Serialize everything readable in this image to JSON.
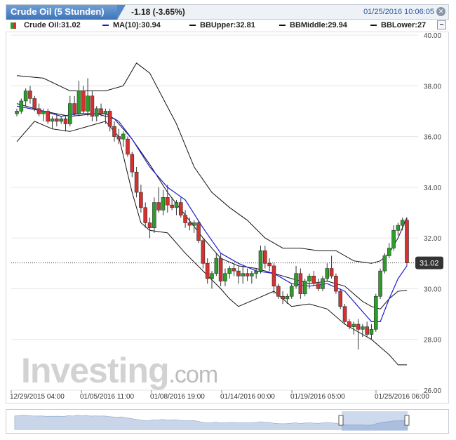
{
  "header": {
    "title": "Crude Oil (5 Stunden)",
    "change": "-1.18 (-3.65%)",
    "datetime": "01/25/2016 10:06:05"
  },
  "legend": {
    "price": "Crude Oil:31.02",
    "ma": "MA(10):30.94",
    "bb_upper": "BBUpper:32.81",
    "bb_middle": "BBMiddle:29.94",
    "bb_lower": "BBLower:27"
  },
  "colors": {
    "up": "#2a9d2a",
    "down": "#d63030",
    "ma": "#1a1ad6",
    "bands": "#111111",
    "grid": "#e3e6ea",
    "navigator": "#6f93c8"
  },
  "watermark": "Investing.com",
  "last_price_label": "31.02",
  "chart_data": {
    "type": "candlestick",
    "ylim": [
      26,
      40
    ],
    "yticks": [
      "40.00",
      "38.00",
      "36.00",
      "34.00",
      "32.00",
      "30.00",
      "28.00",
      "26.00"
    ],
    "xticks": [
      "12/29/2015 04:00",
      "01/05/2016 11:00",
      "01/08/2016 19:00",
      "01/14/2016 00:00",
      "01/19/2016 05:00",
      "01/25/2016 06:00"
    ],
    "last_price": 31.02,
    "candles": [
      [
        36.9,
        37.1,
        36.8,
        37.0
      ],
      [
        37.0,
        37.5,
        36.9,
        37.4
      ],
      [
        37.4,
        37.9,
        37.2,
        37.8
      ],
      [
        37.8,
        38.0,
        37.3,
        37.5
      ],
      [
        37.5,
        37.6,
        37.0,
        37.1
      ],
      [
        37.1,
        37.3,
        36.8,
        36.9
      ],
      [
        36.9,
        37.1,
        36.6,
        37.0
      ],
      [
        37.0,
        37.1,
        36.5,
        36.6
      ],
      [
        36.6,
        36.8,
        36.3,
        36.7
      ],
      [
        36.7,
        36.9,
        36.4,
        36.6
      ],
      [
        36.6,
        36.8,
        36.5,
        36.7
      ],
      [
        36.7,
        36.8,
        36.2,
        36.5
      ],
      [
        36.5,
        37.6,
        36.4,
        37.3
      ],
      [
        37.3,
        37.6,
        36.8,
        36.9
      ],
      [
        36.9,
        38.2,
        36.8,
        37.8
      ],
      [
        37.8,
        38.0,
        36.9,
        37.0
      ],
      [
        37.0,
        38.3,
        36.8,
        37.6
      ],
      [
        37.6,
        37.8,
        36.6,
        36.8
      ],
      [
        36.8,
        37.2,
        36.6,
        37.1
      ],
      [
        37.1,
        37.3,
        36.8,
        36.9
      ],
      [
        36.9,
        37.1,
        36.5,
        37.0
      ],
      [
        37.0,
        37.1,
        36.2,
        36.4
      ],
      [
        36.4,
        36.6,
        35.8,
        36.0
      ],
      [
        36.0,
        36.3,
        35.7,
        35.9
      ],
      [
        35.9,
        36.2,
        35.6,
        36.1
      ],
      [
        35.9,
        36.0,
        35.2,
        35.3
      ],
      [
        35.3,
        35.4,
        34.4,
        34.6
      ],
      [
        34.6,
        34.8,
        33.6,
        33.8
      ],
      [
        33.8,
        34.1,
        33.0,
        33.2
      ],
      [
        33.2,
        33.4,
        32.4,
        32.6
      ],
      [
        32.6,
        32.8,
        32.0,
        32.4
      ],
      [
        32.4,
        33.6,
        32.2,
        33.4
      ],
      [
        33.4,
        34.0,
        33.0,
        33.1
      ],
      [
        33.1,
        33.9,
        32.9,
        33.6
      ],
      [
        33.6,
        34.1,
        33.0,
        33.3
      ],
      [
        33.3,
        33.6,
        33.1,
        33.2
      ],
      [
        33.2,
        33.5,
        32.9,
        33.4
      ],
      [
        33.4,
        33.6,
        32.8,
        32.9
      ],
      [
        32.9,
        33.1,
        32.4,
        32.6
      ],
      [
        32.6,
        32.8,
        32.3,
        32.5
      ],
      [
        32.5,
        32.7,
        32.2,
        32.6
      ],
      [
        32.6,
        32.7,
        31.8,
        31.9
      ],
      [
        31.9,
        32.0,
        30.8,
        31.0
      ],
      [
        31.0,
        31.2,
        30.2,
        30.4
      ],
      [
        30.4,
        30.7,
        30.0,
        30.6
      ],
      [
        30.6,
        31.4,
        30.5,
        31.2
      ],
      [
        31.2,
        31.4,
        30.1,
        30.3
      ],
      [
        30.3,
        30.8,
        30.1,
        30.6
      ],
      [
        30.6,
        30.9,
        30.4,
        30.8
      ],
      [
        30.8,
        31.0,
        30.5,
        30.7
      ],
      [
        30.7,
        30.9,
        30.2,
        30.5
      ],
      [
        30.5,
        30.9,
        30.2,
        30.6
      ],
      [
        30.6,
        30.8,
        30.3,
        30.5
      ],
      [
        30.5,
        30.7,
        30.2,
        30.6
      ],
      [
        30.6,
        30.8,
        30.4,
        30.7
      ],
      [
        30.7,
        31.7,
        30.6,
        31.5
      ],
      [
        31.5,
        31.7,
        30.8,
        31.0
      ],
      [
        31.0,
        31.2,
        30.7,
        30.9
      ],
      [
        30.9,
        31.0,
        29.8,
        30.1
      ],
      [
        30.1,
        30.2,
        29.6,
        29.7
      ],
      [
        29.7,
        29.9,
        29.4,
        29.6
      ],
      [
        29.6,
        29.8,
        29.4,
        29.7
      ],
      [
        29.7,
        30.2,
        29.6,
        30.1
      ],
      [
        30.1,
        30.9,
        30.0,
        30.6
      ],
      [
        30.6,
        30.8,
        29.6,
        29.8
      ],
      [
        29.8,
        30.4,
        29.7,
        30.3
      ],
      [
        30.3,
        30.6,
        30.0,
        30.5
      ],
      [
        30.5,
        30.7,
        30.1,
        30.2
      ],
      [
        30.2,
        30.4,
        29.9,
        30.0
      ],
      [
        30.0,
        30.5,
        29.9,
        30.4
      ],
      [
        30.4,
        31.0,
        30.3,
        30.8
      ],
      [
        30.8,
        31.3,
        30.4,
        30.5
      ],
      [
        30.5,
        30.6,
        29.8,
        29.9
      ],
      [
        29.9,
        30.0,
        29.2,
        29.3
      ],
      [
        29.3,
        29.4,
        28.6,
        28.7
      ],
      [
        28.7,
        28.8,
        28.4,
        28.5
      ],
      [
        28.5,
        28.7,
        28.2,
        28.6
      ],
      [
        28.6,
        28.8,
        27.6,
        28.4
      ],
      [
        28.4,
        28.6,
        28.1,
        28.5
      ],
      [
        28.5,
        28.7,
        28.1,
        28.2
      ],
      [
        28.2,
        28.6,
        28.0,
        28.4
      ],
      [
        28.4,
        29.8,
        28.3,
        29.7
      ],
      [
        29.7,
        30.8,
        29.6,
        30.7
      ],
      [
        30.7,
        31.4,
        30.6,
        31.3
      ],
      [
        31.3,
        31.8,
        31.2,
        31.6
      ],
      [
        31.6,
        32.5,
        31.5,
        32.3
      ],
      [
        32.3,
        32.6,
        32.1,
        32.5
      ],
      [
        32.5,
        32.8,
        32.3,
        32.7
      ],
      [
        32.7,
        32.8,
        30.9,
        31.02
      ]
    ],
    "ma": [
      [
        0,
        37.2
      ],
      [
        6,
        37.0
      ],
      [
        10,
        36.8
      ],
      [
        14,
        36.9
      ],
      [
        20,
        36.9
      ],
      [
        23,
        36.6
      ],
      [
        26,
        35.9
      ],
      [
        30,
        34.8
      ],
      [
        34,
        34.0
      ],
      [
        38,
        33.5
      ],
      [
        42,
        32.4
      ],
      [
        46,
        31.4
      ],
      [
        50,
        31.0
      ],
      [
        54,
        30.7
      ],
      [
        58,
        30.6
      ],
      [
        62,
        30.2
      ],
      [
        66,
        30.1
      ],
      [
        70,
        30.2
      ],
      [
        74,
        29.9
      ],
      [
        78,
        29.1
      ],
      [
        80,
        28.7
      ],
      [
        82,
        28.7
      ],
      [
        84,
        29.6
      ],
      [
        86,
        30.4
      ],
      [
        88,
        30.9
      ]
    ],
    "bb_upper": [
      [
        0,
        38.4
      ],
      [
        6,
        38.3
      ],
      [
        12,
        37.8
      ],
      [
        16,
        37.8
      ],
      [
        20,
        37.8
      ],
      [
        24,
        38.0
      ],
      [
        27,
        38.9
      ],
      [
        30,
        38.5
      ],
      [
        33,
        37.5
      ],
      [
        36,
        36.5
      ],
      [
        40,
        34.8
      ],
      [
        44,
        33.8
      ],
      [
        48,
        33.2
      ],
      [
        52,
        32.7
      ],
      [
        56,
        32.0
      ],
      [
        60,
        31.6
      ],
      [
        64,
        31.6
      ],
      [
        68,
        31.5
      ],
      [
        72,
        31.5
      ],
      [
        76,
        31.1
      ],
      [
        80,
        31.0
      ],
      [
        82,
        31.1
      ],
      [
        84,
        31.4
      ],
      [
        86,
        32.0
      ],
      [
        88,
        32.81
      ]
    ],
    "bb_middle": [
      [
        0,
        37.3
      ],
      [
        6,
        37.0
      ],
      [
        12,
        36.8
      ],
      [
        18,
        36.9
      ],
      [
        22,
        36.7
      ],
      [
        26,
        35.9
      ],
      [
        30,
        34.9
      ],
      [
        34,
        33.8
      ],
      [
        38,
        32.9
      ],
      [
        42,
        32.0
      ],
      [
        46,
        31.2
      ],
      [
        50,
        30.9
      ],
      [
        54,
        30.8
      ],
      [
        58,
        30.6
      ],
      [
        62,
        30.4
      ],
      [
        66,
        30.2
      ],
      [
        70,
        30.3
      ],
      [
        74,
        30.1
      ],
      [
        78,
        29.5
      ],
      [
        80,
        29.3
      ],
      [
        82,
        29.2
      ],
      [
        84,
        29.6
      ],
      [
        86,
        29.9
      ],
      [
        88,
        29.94
      ]
    ],
    "bb_lower": [
      [
        0,
        35.8
      ],
      [
        4,
        36.6
      ],
      [
        8,
        36.3
      ],
      [
        12,
        36.2
      ],
      [
        16,
        36.4
      ],
      [
        20,
        36.6
      ],
      [
        23,
        36.0
      ],
      [
        26,
        33.8
      ],
      [
        28,
        32.6
      ],
      [
        30,
        32.3
      ],
      [
        34,
        32.2
      ],
      [
        38,
        31.4
      ],
      [
        42,
        30.7
      ],
      [
        46,
        30.0
      ],
      [
        48,
        29.6
      ],
      [
        50,
        29.3
      ],
      [
        54,
        29.6
      ],
      [
        58,
        29.9
      ],
      [
        62,
        29.3
      ],
      [
        66,
        29.4
      ],
      [
        70,
        29.2
      ],
      [
        74,
        28.6
      ],
      [
        78,
        28.2
      ],
      [
        80,
        28.0
      ],
      [
        82,
        27.7
      ],
      [
        84,
        27.4
      ],
      [
        86,
        27.0
      ],
      [
        88,
        27.0
      ]
    ]
  }
}
